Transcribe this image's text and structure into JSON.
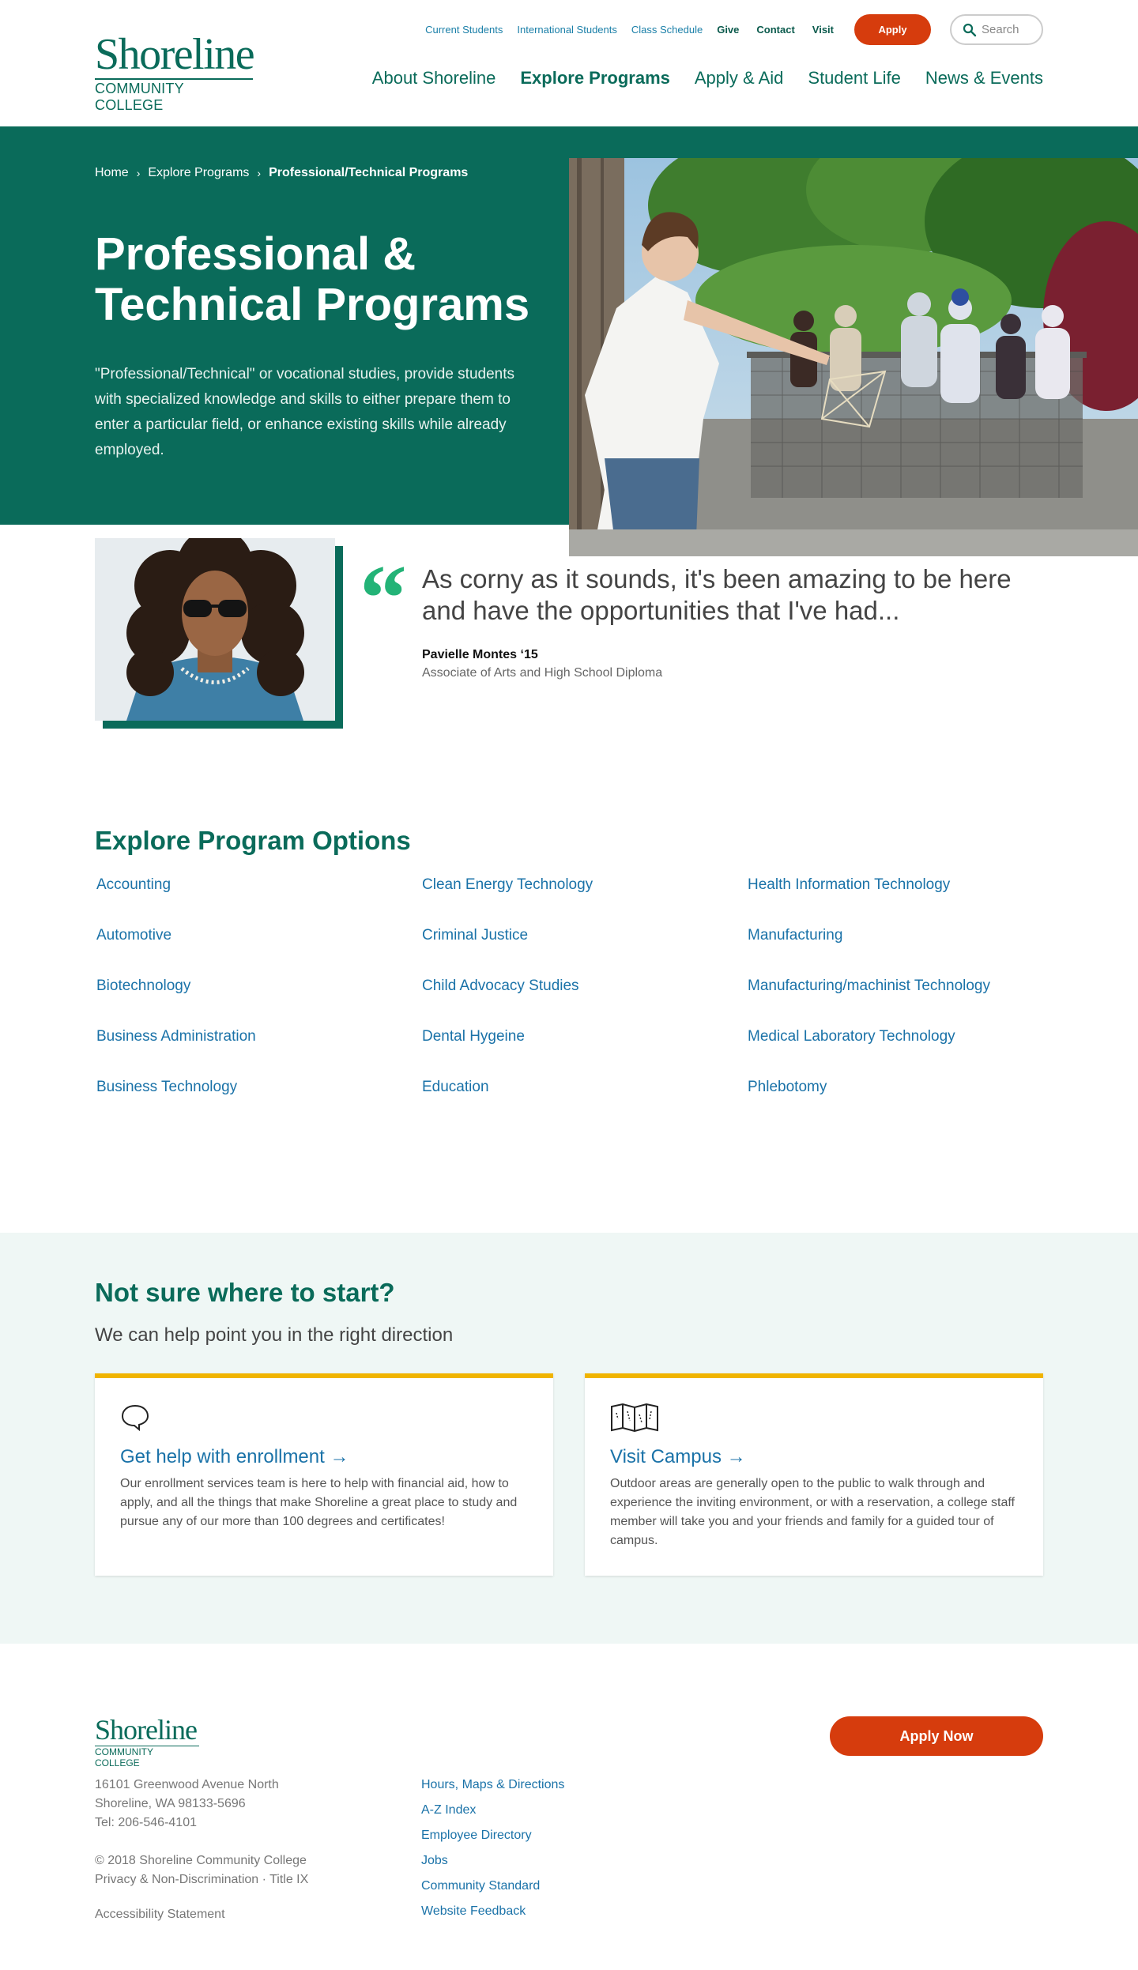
{
  "logo": {
    "main": "Shoreline",
    "sub": "COMMUNITY COLLEGE"
  },
  "utility_nav": {
    "links": [
      "Current Students",
      "International Students",
      "Class Schedule"
    ],
    "bold_links": [
      "Give",
      "Contact",
      "Visit"
    ],
    "apply": "Apply",
    "search_placeholder": "Search"
  },
  "main_nav": [
    "About Shoreline",
    "Explore Programs",
    "Apply & Aid",
    "Student Life",
    "News & Events"
  ],
  "breadcrumb": [
    "Home",
    "Explore Programs",
    "Professional/Technical Programs"
  ],
  "hero": {
    "title": "Professional & Technical Programs",
    "description": "\"Professional/Technical\" or vocational studies, provide students with specialized knowledge and skills to either prepare them to enter a particular field, or enhance existing skills while already employed."
  },
  "testimonial": {
    "quote_mark": "“",
    "text": "As corny as it sounds, it's been amazing to be here and have the opportunities that I've had...",
    "name": "Pavielle Montes ‘15",
    "degree": "Associate of Arts and High School Diploma"
  },
  "programs": {
    "title": "Explore Program Options",
    "col1": [
      "Accounting",
      "Automotive",
      "Biotechnology",
      "Business Administration",
      "Business Technology"
    ],
    "col2": [
      "Clean Energy Technology",
      "Criminal Justice",
      "Child Advocacy Studies",
      "Dental Hygeine",
      "Education"
    ],
    "col3": [
      "Health Information Technology",
      "Manufacturing",
      "Manufacturing/machinist Technology",
      "Medical Laboratory Technology",
      "Phlebotomy"
    ]
  },
  "help": {
    "title": "Not sure where to start?",
    "subtitle": "We can help point you in the right direction",
    "cards": [
      {
        "title": "Get help with enrollment",
        "icon": "chat-bubble-icon",
        "description": "Our enrollment services team is here to help with financial aid, how to apply, and all the things that make Shoreline a great place to study and pursue any of our more than 100 degrees and certificates!"
      },
      {
        "title": "Visit Campus",
        "icon": "map-icon",
        "description": "Outdoor areas are generally open to the public to walk through and experience the inviting environment, or with a reservation, a college staff member will take you and your friends and family for a guided tour of campus."
      }
    ]
  },
  "footer": {
    "address": [
      "16101 Greenwood Avenue North",
      "Shoreline, WA 98133-5696",
      "Tel: 206-546-4101"
    ],
    "copyright": "© 2018 Shoreline Community College",
    "legal": "Privacy & Non-Discrimination · Title IX",
    "accessibility": "Accessibility Statement",
    "links": [
      "Hours, Maps & Directions",
      "A-Z Index",
      "Employee Directory",
      "Jobs",
      "Community Standard",
      "Website Feedback"
    ],
    "apply_now": "Apply Now"
  },
  "colors": {
    "brand_green": "#0a6b5a",
    "apply_orange": "#d63c0d",
    "link_blue": "#1a72a8",
    "quote_green": "#23b377",
    "card_accent": "#f0b400"
  }
}
